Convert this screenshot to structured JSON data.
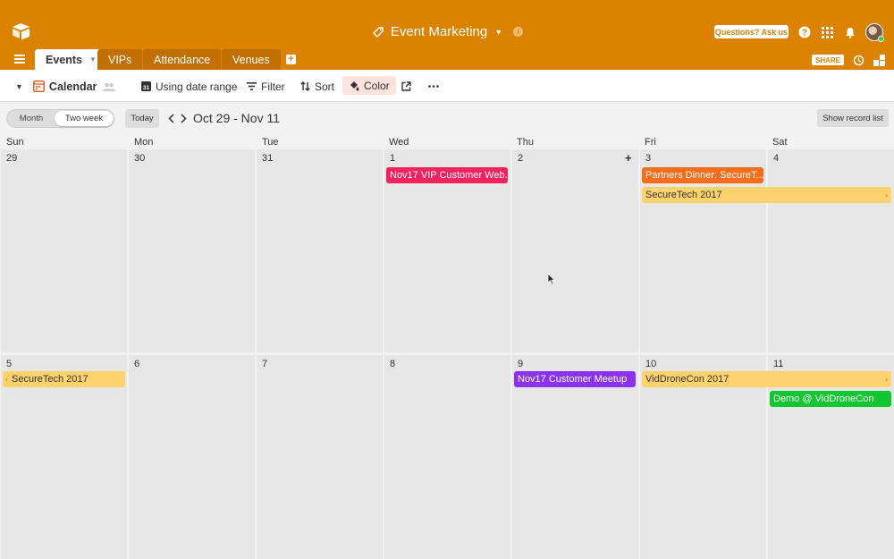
{
  "header": {
    "base_name": "Event Marketing",
    "help_label": "Questions? Ask us",
    "share_label": "SHARE"
  },
  "tabs": [
    {
      "label": "Events"
    },
    {
      "label": "VIPs"
    },
    {
      "label": "Attendance"
    },
    {
      "label": "Venues"
    }
  ],
  "viewbar": {
    "view_name": "Calendar",
    "date_range_label": "Using date range",
    "filter_label": "Filter",
    "sort_label": "Sort",
    "color_label": "Color"
  },
  "calendar": {
    "mode_month": "Month",
    "mode_two_week": "Two week",
    "selected_mode": "Two week",
    "today_label": "Today",
    "range_label": "Oct 29 - Nov 11",
    "record_list_label": "Show record list",
    "weekdays": [
      "Sun",
      "Mon",
      "Tue",
      "Wed",
      "Thu",
      "Fri",
      "Sat"
    ],
    "week1_days": [
      "29",
      "30",
      "31",
      "1",
      "2",
      "3",
      "4"
    ],
    "week2_days": [
      "5",
      "6",
      "7",
      "8",
      "9",
      "10",
      "11"
    ]
  },
  "events": {
    "vip_webinar": {
      "title": "Nov17 VIP Customer Web...",
      "color": "#f4215f"
    },
    "partners_dinner": {
      "title": "Partners Dinner: SecureT...",
      "color": "#f76d1a"
    },
    "securetech_w1": {
      "title": "SecureTech 2017",
      "color": "#ffd36b"
    },
    "securetech_w2": {
      "title": "SecureTech 2017",
      "color": "#ffd36b"
    },
    "customer_meetup": {
      "title": "Nov17 Customer Meetup",
      "color": "#8b32f0"
    },
    "viddronecon": {
      "title": "VidDroneCon 2017",
      "color": "#ffd36b"
    },
    "demo_viddronecon": {
      "title": "Demo @ VidDroneCon",
      "color": "#11c630"
    }
  },
  "colors": {
    "header_bg": "#db8200",
    "tab_inactive_bg": "#c06f00",
    "cell_bg": "#e6e6e6"
  }
}
